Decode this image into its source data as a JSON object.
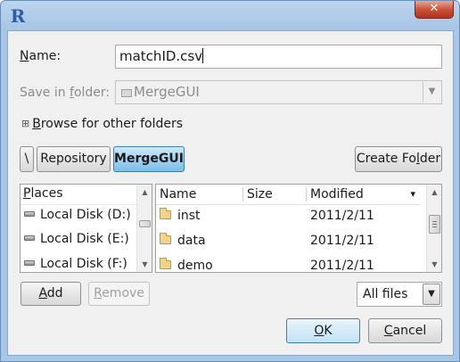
{
  "window": {
    "app_icon": "R",
    "close_glyph": "✕"
  },
  "name_field": {
    "label_mnemonic": "N",
    "label_rest": "ame:",
    "value": "matchID.csv"
  },
  "save_in": {
    "label_pre": "Save in ",
    "label_mnemonic": "f",
    "label_post": "older:",
    "value": "MergeGUI"
  },
  "browse": {
    "toggle": "⊞",
    "label_mnemonic": "B",
    "label_rest": "rowse for other folders"
  },
  "path_bar": {
    "root": "\\",
    "segments": [
      {
        "label": "Repository",
        "active": false
      },
      {
        "label": "MergeGUI",
        "active": true
      }
    ],
    "create_pre": "Create Fo",
    "create_mnemonic": "l",
    "create_post": "der"
  },
  "places": {
    "header_mnemonic": "P",
    "header_rest": "laces",
    "items": [
      {
        "label": "Local Disk (D:)",
        "icon": "hard-disk-icon"
      },
      {
        "label": "Local Disk (E:)",
        "icon": "hard-disk-icon"
      },
      {
        "label": "Local Disk (F:)",
        "icon": "hard-disk-icon"
      }
    ]
  },
  "files": {
    "columns": {
      "name": "Name",
      "size": "Size",
      "modified": "Modified"
    },
    "sort_indicator": "▾",
    "rows": [
      {
        "name": "inst",
        "size": "",
        "modified": "2011/2/11",
        "icon": "folder-icon"
      },
      {
        "name": "data",
        "size": "",
        "modified": "2011/2/11",
        "icon": "folder-icon"
      },
      {
        "name": "demo",
        "size": "",
        "modified": "2011/2/11",
        "icon": "folder-icon"
      }
    ]
  },
  "buttons": {
    "add_mnemonic": "A",
    "add_rest": "dd",
    "remove_mnemonic": "R",
    "remove_rest": "emove",
    "ok_mnemonic": "O",
    "ok_rest": "K",
    "cancel_mnemonic": "C",
    "cancel_rest": "ancel"
  },
  "filter": {
    "value": "All files"
  },
  "colors": {
    "accent": "#7cbde9",
    "title_bar": "#a9c6e6",
    "close": "#c7543d"
  }
}
